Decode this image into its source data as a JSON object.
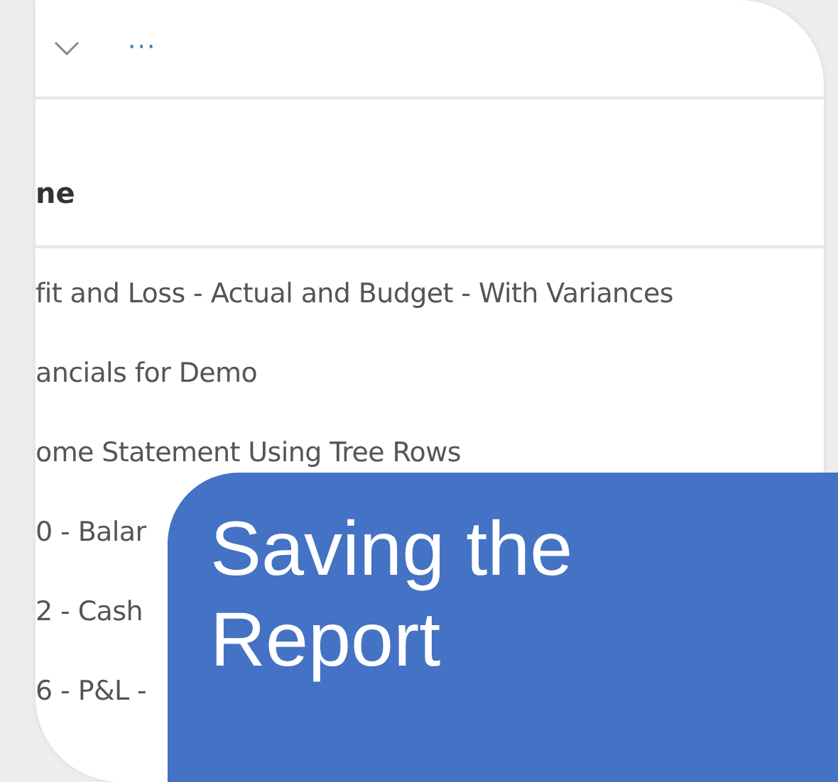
{
  "toolbar": {
    "menu_glyph": "···"
  },
  "table": {
    "column_header": "ne",
    "rows": [
      {
        "name": "fit and Loss - Actual and Budget - With Variances"
      },
      {
        "name": "ancials for Demo"
      },
      {
        "name": "ome Statement Using Tree Rows"
      },
      {
        "name": "0 - Balar"
      },
      {
        "name": "2 - Cash"
      },
      {
        "name": "6 - P&L -"
      }
    ]
  },
  "title_overlay": {
    "title": "Saving the Report"
  }
}
